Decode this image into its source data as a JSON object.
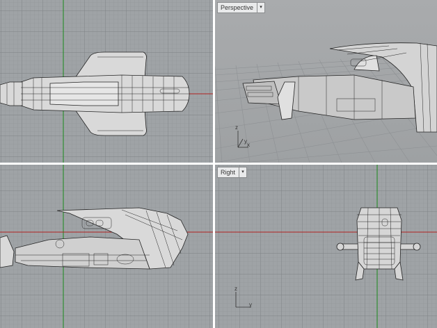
{
  "viewports": {
    "top": {
      "label": ""
    },
    "perspective": {
      "label": "Perspective",
      "menu_icon": "dropdown-arrow-icon"
    },
    "front": {
      "label": ""
    },
    "right": {
      "label": "Right",
      "menu_icon": "dropdown-arrow-icon"
    }
  },
  "axes": {
    "perspective": {
      "z": "z",
      "x": "x",
      "y": "y"
    },
    "right": {
      "z": "z",
      "y": "y"
    }
  },
  "colors": {
    "grid_bg": "#9fa3a6",
    "grid_line": "#8f9396",
    "grid_major": "#7d8184",
    "x_axis": "#b02020",
    "y_axis": "#1a8a1a",
    "model_fill": "#d9d9d9",
    "model_stroke": "#222222"
  }
}
